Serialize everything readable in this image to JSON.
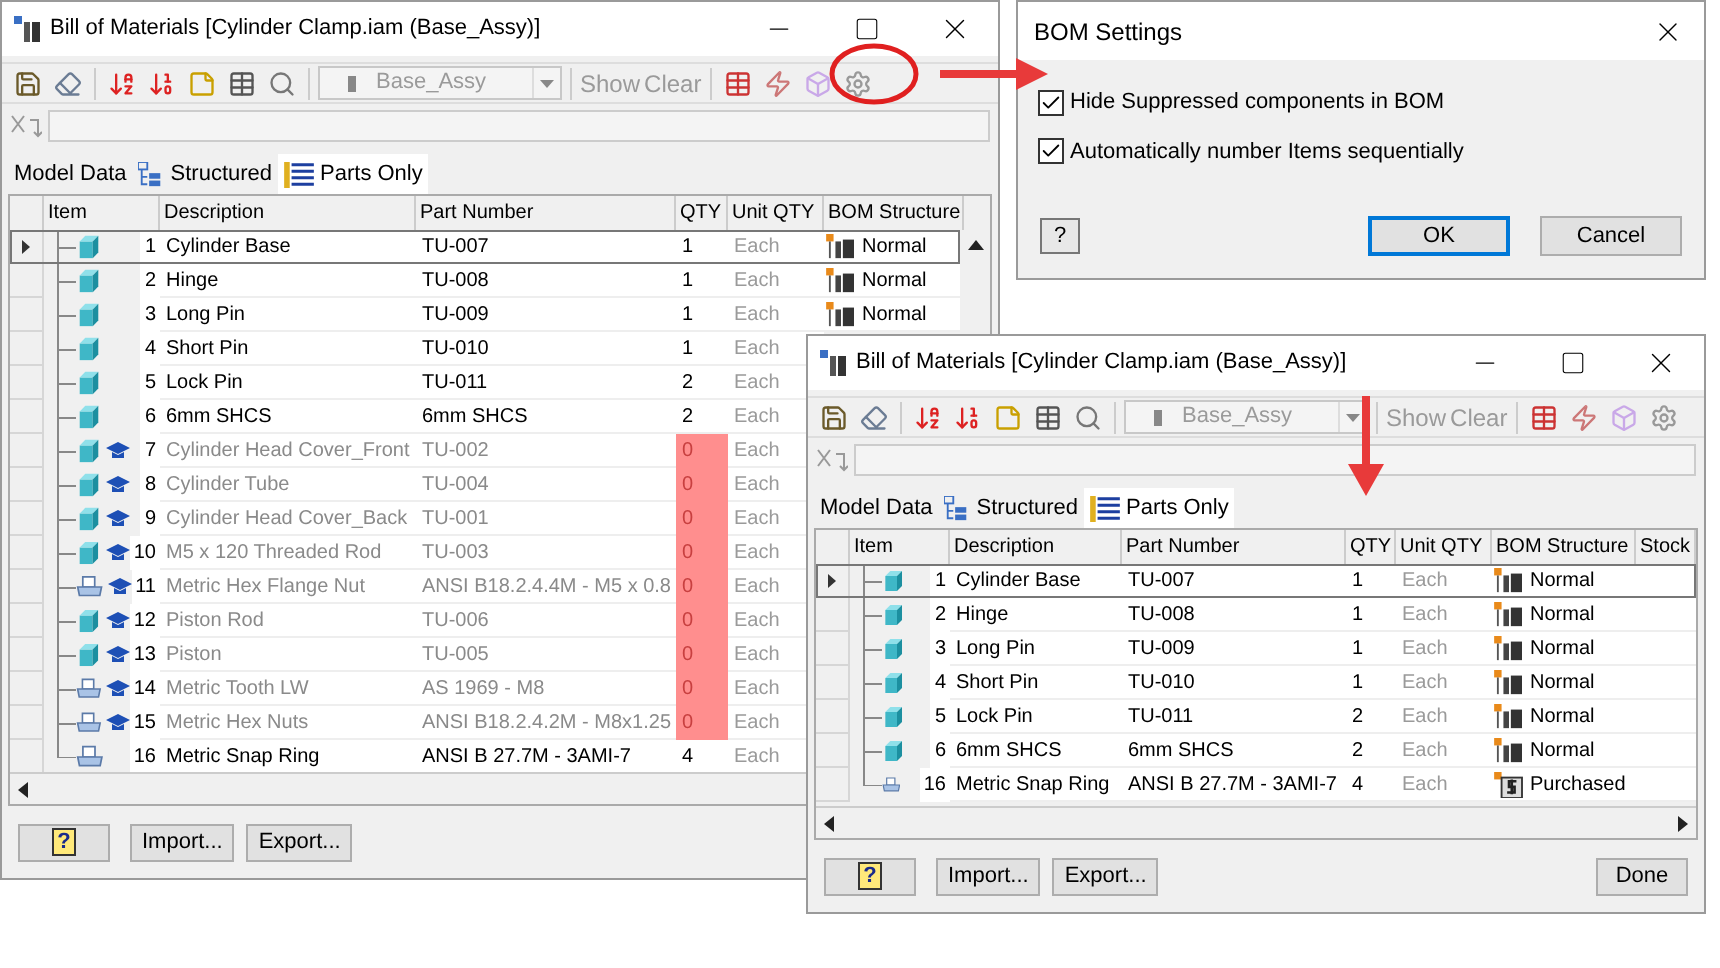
{
  "windows": [
    {
      "title": "Bill of Materials [Cylinder Clamp.iam (Base_Assy)]",
      "toolbar": {
        "view": {
          "value": "Base_Assy",
          "disabled": true
        },
        "show": {
          "label": "Show",
          "disabled": true
        },
        "clear": {
          "label": "Clear",
          "disabled": true
        }
      },
      "tabs": [
        {
          "label": "Model Data",
          "selected": false,
          "kind": "plain"
        },
        {
          "label": "Structured",
          "selected": false,
          "kind": "structured"
        },
        {
          "label": "Parts Only",
          "selected": true,
          "kind": "parts"
        }
      ],
      "columns": [
        "Item",
        "Description",
        "Part Number",
        "QTY",
        "Unit QTY",
        "BOM Structure"
      ],
      "rows": [
        {
          "item": "1",
          "description": "Cylinder Base",
          "part_number": "TU-007",
          "qty": "1",
          "unit_qty": "Each",
          "bom_structure": {
            "label": "Normal",
            "kind": "normal"
          },
          "kind": "part",
          "suppressed": false,
          "selected": true
        },
        {
          "item": "2",
          "description": "Hinge",
          "part_number": "TU-008",
          "qty": "1",
          "unit_qty": "Each",
          "bom_structure": {
            "label": "Normal",
            "kind": "normal"
          },
          "kind": "part",
          "suppressed": false,
          "selected": false
        },
        {
          "item": "3",
          "description": "Long Pin",
          "part_number": "TU-009",
          "qty": "1",
          "unit_qty": "Each",
          "bom_structure": {
            "label": "Normal",
            "kind": "normal"
          },
          "kind": "part",
          "suppressed": false,
          "selected": false
        },
        {
          "item": "4",
          "description": "Short Pin",
          "part_number": "TU-010",
          "qty": "1",
          "unit_qty": "Each",
          "kind": "part",
          "suppressed": false,
          "selected": false
        },
        {
          "item": "5",
          "description": "Lock Pin",
          "part_number": "TU-011",
          "qty": "2",
          "unit_qty": "Each",
          "kind": "part",
          "suppressed": false,
          "selected": false
        },
        {
          "item": "6",
          "description": "6mm SHCS",
          "part_number": "6mm SHCS",
          "qty": "2",
          "unit_qty": "Each",
          "kind": "part",
          "suppressed": false,
          "selected": false
        },
        {
          "item": "7",
          "description": "Cylinder Head Cover_Front",
          "part_number": "TU-002",
          "qty": "0",
          "unit_qty": "Each",
          "kind": "part",
          "suppressed": true,
          "selected": false
        },
        {
          "item": "8",
          "description": "Cylinder Tube",
          "part_number": "TU-004",
          "qty": "0",
          "unit_qty": "Each",
          "kind": "part",
          "suppressed": true,
          "selected": false
        },
        {
          "item": "9",
          "description": "Cylinder Head Cover_Back",
          "part_number": "TU-001",
          "qty": "0",
          "unit_qty": "Each",
          "kind": "part",
          "suppressed": true,
          "selected": false
        },
        {
          "item": "10",
          "description": "M5 x 120 Threaded Rod",
          "part_number": "TU-003",
          "qty": "0",
          "unit_qty": "Each",
          "kind": "part",
          "suppressed": true,
          "selected": false
        },
        {
          "item": "11",
          "description": "Metric Hex Flange Nut",
          "part_number": "ANSI B18.2.4.4M - M5 x 0.8",
          "qty": "0",
          "unit_qty": "Each",
          "kind": "library",
          "suppressed": true,
          "selected": false
        },
        {
          "item": "12",
          "description": "Piston Rod",
          "part_number": "TU-006",
          "qty": "0",
          "unit_qty": "Each",
          "kind": "part",
          "suppressed": true,
          "selected": false
        },
        {
          "item": "13",
          "description": "Piston",
          "part_number": "TU-005",
          "qty": "0",
          "unit_qty": "Each",
          "kind": "part",
          "suppressed": true,
          "selected": false
        },
        {
          "item": "14",
          "description": "Metric Tooth LW",
          "part_number": "AS 1969 - M8",
          "qty": "0",
          "unit_qty": "Each",
          "kind": "library",
          "suppressed": true,
          "selected": false
        },
        {
          "item": "15",
          "description": "Metric Hex Nuts",
          "part_number": "ANSI B18.2.4.2M - M8x1.25",
          "qty": "0",
          "unit_qty": "Each",
          "kind": "library",
          "suppressed": true,
          "selected": false
        },
        {
          "item": "16",
          "description": "Metric Snap Ring",
          "part_number": "ANSI B 27.7M - 3AMI-7",
          "qty": "4",
          "unit_qty": "Each",
          "kind": "library",
          "suppressed": false,
          "selected": false
        }
      ],
      "buttons": [
        {
          "label": "?",
          "kind": "help"
        },
        {
          "label": "Import...",
          "kind": "action"
        },
        {
          "label": "Export...",
          "kind": "action"
        }
      ]
    },
    {
      "title": "Bill of Materials [Cylinder Clamp.iam (Base_Assy)]",
      "toolbar": {
        "view": {
          "value": "Base_Assy",
          "disabled": true
        },
        "show": {
          "label": "Show",
          "disabled": true
        },
        "clear": {
          "label": "Clear",
          "disabled": true
        }
      },
      "tabs": [
        {
          "label": "Model Data",
          "selected": false,
          "kind": "plain"
        },
        {
          "label": "Structured",
          "selected": false,
          "kind": "structured"
        },
        {
          "label": "Parts Only",
          "selected": true,
          "kind": "parts"
        }
      ],
      "columns": [
        "Item",
        "Description",
        "Part Number",
        "QTY",
        "Unit QTY",
        "BOM Structure",
        "Stock"
      ],
      "rows": [
        {
          "item": "1",
          "description": "Cylinder Base",
          "part_number": "TU-007",
          "qty": "1",
          "unit_qty": "Each",
          "bom_structure": {
            "label": "Normal",
            "kind": "normal"
          },
          "kind": "part",
          "suppressed": false,
          "selected": true
        },
        {
          "item": "2",
          "description": "Hinge",
          "part_number": "TU-008",
          "qty": "1",
          "unit_qty": "Each",
          "bom_structure": {
            "label": "Normal",
            "kind": "normal"
          },
          "kind": "part",
          "suppressed": false,
          "selected": false
        },
        {
          "item": "3",
          "description": "Long Pin",
          "part_number": "TU-009",
          "qty": "1",
          "unit_qty": "Each",
          "bom_structure": {
            "label": "Normal",
            "kind": "normal"
          },
          "kind": "part",
          "suppressed": false,
          "selected": false
        },
        {
          "item": "4",
          "description": "Short Pin",
          "part_number": "TU-010",
          "qty": "1",
          "unit_qty": "Each",
          "bom_structure": {
            "label": "Normal",
            "kind": "normal"
          },
          "kind": "part",
          "suppressed": false,
          "selected": false
        },
        {
          "item": "5",
          "description": "Lock Pin",
          "part_number": "TU-011",
          "qty": "2",
          "unit_qty": "Each",
          "bom_structure": {
            "label": "Normal",
            "kind": "normal"
          },
          "kind": "part",
          "suppressed": false,
          "selected": false
        },
        {
          "item": "6",
          "description": "6mm SHCS",
          "part_number": "6mm SHCS",
          "qty": "2",
          "unit_qty": "Each",
          "bom_structure": {
            "label": "Normal",
            "kind": "normal"
          },
          "kind": "part",
          "suppressed": false,
          "selected": false
        },
        {
          "item": "16",
          "description": "Metric Snap Ring",
          "part_number": "ANSI B 27.7M - 3AMI-7",
          "qty": "4",
          "unit_qty": "Each",
          "bom_structure": {
            "label": "Purchased",
            "kind": "purchased"
          },
          "kind": "library",
          "suppressed": false,
          "selected": false
        }
      ],
      "buttons": [
        {
          "label": "?",
          "kind": "help"
        },
        {
          "label": "Import...",
          "kind": "action"
        },
        {
          "label": "Export...",
          "kind": "action"
        },
        {
          "label": "Done",
          "kind": "close"
        }
      ]
    }
  ],
  "dialog": {
    "title": "BOM Settings",
    "options": [
      {
        "label": "Hide Suppressed components in BOM",
        "checked": true
      },
      {
        "label": "Automatically number Items sequentially",
        "checked": true
      }
    ],
    "buttons": [
      {
        "label": "?",
        "kind": "help"
      },
      {
        "label": "OK",
        "kind": "default"
      },
      {
        "label": "Cancel",
        "kind": "action"
      }
    ]
  }
}
